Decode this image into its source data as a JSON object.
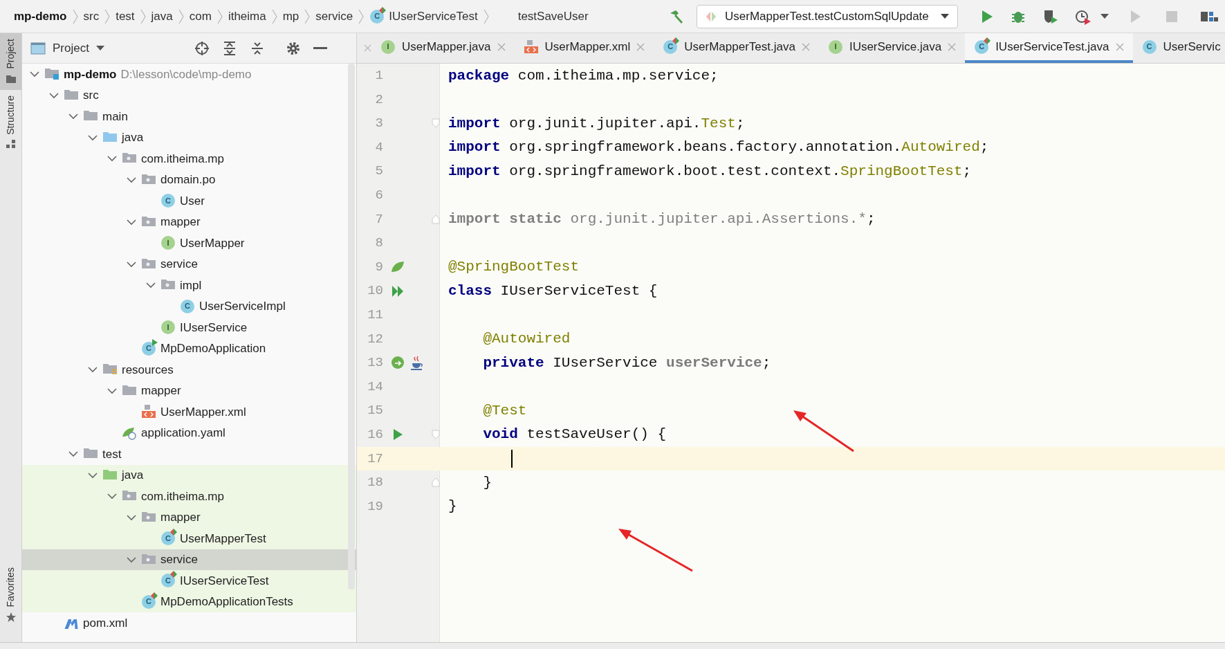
{
  "breadcrumb": {
    "items": [
      {
        "label": "mp-demo",
        "bold": true
      },
      {
        "label": "src",
        "bold": false
      },
      {
        "label": "test",
        "bold": false
      },
      {
        "label": "java",
        "bold": false
      },
      {
        "label": "com",
        "bold": false
      },
      {
        "label": "itheima",
        "bold": false
      },
      {
        "label": "mp",
        "bold": false
      },
      {
        "label": "service",
        "bold": false
      },
      {
        "label": "IUserServiceTest",
        "bold": false,
        "kind": "test_class",
        "badge": "C"
      }
    ],
    "method": "testSaveUser"
  },
  "run_config": {
    "label": "UserMapperTest.testCustomSqlUpdate"
  },
  "tool_windows_top": [
    {
      "label": "Project",
      "kind": "project",
      "selected": true
    },
    {
      "label": "Structure",
      "kind": "structure",
      "selected": false
    }
  ],
  "tool_windows_bottom": [
    {
      "label": "Favorites",
      "kind": "favorites",
      "selected": false
    }
  ],
  "project_panel": {
    "title": "Project"
  },
  "tree": [
    {
      "label": "mp-demo",
      "bold": true,
      "path": "D:\\lesson\\code\\mp-demo",
      "kind": "module",
      "expanded": true,
      "selected": false,
      "test_scope": false,
      "children": [
        {
          "label": "src",
          "kind": "folder",
          "expanded": true,
          "selected": false,
          "test_scope": false,
          "children": [
            {
              "label": "main",
              "kind": "folder",
              "expanded": true,
              "selected": false,
              "test_scope": false,
              "children": [
                {
                  "label": "java",
                  "kind": "source_folder",
                  "expanded": true,
                  "selected": false,
                  "test_scope": false,
                  "children": [
                    {
                      "label": "com.itheima.mp",
                      "kind": "package",
                      "expanded": true,
                      "selected": false,
                      "test_scope": false,
                      "children": [
                        {
                          "label": "domain.po",
                          "kind": "package",
                          "expanded": true,
                          "selected": false,
                          "test_scope": false,
                          "children": [
                            {
                              "label": "User",
                              "kind": "class",
                              "badge": "C",
                              "selected": false,
                              "test_scope": false
                            }
                          ]
                        },
                        {
                          "label": "mapper",
                          "kind": "package",
                          "expanded": true,
                          "selected": false,
                          "test_scope": false,
                          "children": [
                            {
                              "label": "UserMapper",
                              "kind": "interface",
                              "badge": "I",
                              "selected": false,
                              "test_scope": false
                            }
                          ]
                        },
                        {
                          "label": "service",
                          "kind": "package",
                          "expanded": true,
                          "selected": false,
                          "test_scope": false,
                          "children": [
                            {
                              "label": "impl",
                              "kind": "package",
                              "expanded": true,
                              "selected": false,
                              "test_scope": false,
                              "children": [
                                {
                                  "label": "UserServiceImpl",
                                  "kind": "class",
                                  "badge": "C",
                                  "selected": false,
                                  "test_scope": false
                                }
                              ]
                            },
                            {
                              "label": "IUserService",
                              "kind": "interface",
                              "badge": "I",
                              "selected": false,
                              "test_scope": false
                            }
                          ]
                        },
                        {
                          "label": "MpDemoApplication",
                          "kind": "app_class",
                          "badge": "C",
                          "selected": false,
                          "test_scope": false
                        }
                      ]
                    }
                  ]
                },
                {
                  "label": "resources",
                  "kind": "resources_folder",
                  "expanded": true,
                  "selected": false,
                  "test_scope": false,
                  "children": [
                    {
                      "label": "mapper",
                      "kind": "folder",
                      "expanded": true,
                      "selected": false,
                      "test_scope": false,
                      "children": [
                        {
                          "label": "UserMapper.xml",
                          "kind": "xml",
                          "selected": false,
                          "test_scope": false
                        }
                      ]
                    },
                    {
                      "label": "application.yaml",
                      "kind": "yaml",
                      "selected": false,
                      "test_scope": false
                    }
                  ]
                }
              ]
            },
            {
              "label": "test",
              "kind": "folder",
              "expanded": true,
              "selected": false,
              "test_scope": false,
              "children": [
                {
                  "label": "java",
                  "kind": "test_folder",
                  "expanded": true,
                  "selected": false,
                  "test_scope": true,
                  "children": [
                    {
                      "label": "com.itheima.mp",
                      "kind": "package",
                      "expanded": true,
                      "selected": false,
                      "test_scope": true,
                      "children": [
                        {
                          "label": "mapper",
                          "kind": "package",
                          "expanded": true,
                          "selected": false,
                          "test_scope": true,
                          "children": [
                            {
                              "label": "UserMapperTest",
                              "kind": "test_class",
                              "badge": "C",
                              "selected": false,
                              "test_scope": true
                            }
                          ]
                        },
                        {
                          "label": "service",
                          "kind": "package",
                          "expanded": true,
                          "selected": true,
                          "test_scope": true,
                          "children": [
                            {
                              "label": "IUserServiceTest",
                              "kind": "test_class",
                              "badge": "C",
                              "selected": false,
                              "test_scope": true
                            }
                          ]
                        },
                        {
                          "label": "MpDemoApplicationTests",
                          "kind": "test_class",
                          "badge": "C",
                          "selected": false,
                          "test_scope": true
                        }
                      ]
                    }
                  ]
                }
              ]
            }
          ]
        },
        {
          "label": "pom.xml",
          "kind": "maven",
          "selected": false,
          "test_scope": false
        }
      ]
    }
  ],
  "tabs": [
    {
      "label": "UserMapper.java",
      "kind": "interface",
      "badge": "I",
      "selected": false
    },
    {
      "label": "UserMapper.xml",
      "kind": "xml",
      "selected": false
    },
    {
      "label": "UserMapperTest.java",
      "kind": "test_class",
      "badge": "C",
      "selected": false
    },
    {
      "label": "IUserService.java",
      "kind": "interface",
      "badge": "I",
      "selected": false
    },
    {
      "label": "IUserServiceTest.java",
      "kind": "test_class",
      "badge": "C",
      "selected": true
    },
    {
      "label": "UserServic",
      "kind": "class",
      "badge": "C",
      "selected": false
    }
  ],
  "code": [
    {
      "number": "1",
      "tokens": [
        {
          "kind": "keyword",
          "text": "package"
        },
        {
          "kind": "plain",
          "text": " com.itheima.mp.service;"
        }
      ]
    },
    {
      "number": "2"
    },
    {
      "number": "3",
      "fold": {
        "kind": "start"
      },
      "tokens": [
        {
          "kind": "keyword",
          "text": "import"
        },
        {
          "kind": "plain",
          "text": " org.junit.jupiter.api."
        },
        {
          "kind": "type_ref",
          "text": "Test"
        },
        {
          "kind": "plain",
          "text": ";"
        }
      ]
    },
    {
      "number": "4",
      "tokens": [
        {
          "kind": "keyword",
          "text": "import"
        },
        {
          "kind": "plain",
          "text": " org.springframework.beans.factory.annotation."
        },
        {
          "kind": "type_ref",
          "text": "Autowired"
        },
        {
          "kind": "plain",
          "text": ";"
        }
      ]
    },
    {
      "number": "5",
      "tokens": [
        {
          "kind": "keyword",
          "text": "import"
        },
        {
          "kind": "plain",
          "text": " org.springframework.boot.test.context."
        },
        {
          "kind": "type_ref",
          "text": "SpringBootTest"
        },
        {
          "kind": "plain",
          "text": ";"
        }
      ]
    },
    {
      "number": "6"
    },
    {
      "number": "7",
      "fold": {
        "kind": "end"
      },
      "tokens": [
        {
          "kind": "unused_keyword",
          "text": "import static"
        },
        {
          "kind": "unused",
          "text": " org.junit.jupiter.api.Assertions.*"
        },
        {
          "kind": "plain",
          "text": ";"
        }
      ]
    },
    {
      "number": "8"
    },
    {
      "number": "9",
      "markers": [
        {
          "kind": "spring"
        }
      ],
      "tokens": [
        {
          "kind": "annotation",
          "text": "@SpringBootTest"
        }
      ]
    },
    {
      "number": "10",
      "markers": [
        {
          "kind": "run_all"
        }
      ],
      "tokens": [
        {
          "kind": "keyword",
          "text": "class"
        },
        {
          "kind": "plain",
          "text": " IUserServiceTest {"
        }
      ]
    },
    {
      "number": "11"
    },
    {
      "number": "12",
      "tokens": [
        {
          "kind": "annotation",
          "text": "    @Autowired"
        }
      ]
    },
    {
      "number": "13",
      "markers": [
        {
          "kind": "bean"
        },
        {
          "kind": "java"
        }
      ],
      "tokens": [
        {
          "kind": "keyword",
          "text": "    private"
        },
        {
          "kind": "plain",
          "text": " IUserService "
        },
        {
          "kind": "field",
          "text": "userService"
        },
        {
          "kind": "plain",
          "text": ";"
        }
      ]
    },
    {
      "number": "14"
    },
    {
      "number": "15",
      "tokens": [
        {
          "kind": "annotation",
          "text": "    @Test"
        }
      ]
    },
    {
      "number": "16",
      "markers": [
        {
          "kind": "run"
        }
      ],
      "fold": {
        "kind": "start"
      },
      "tokens": [
        {
          "kind": "keyword",
          "text": "    void"
        },
        {
          "kind": "plain",
          "text": " testSaveUser() {"
        }
      ]
    },
    {
      "number": "17",
      "current": true
    },
    {
      "number": "18",
      "fold": {
        "kind": "end"
      },
      "tokens": [
        {
          "kind": "plain",
          "text": "    }"
        }
      ]
    },
    {
      "number": "19",
      "tokens": [
        {
          "kind": "plain",
          "text": "}"
        }
      ]
    }
  ]
}
